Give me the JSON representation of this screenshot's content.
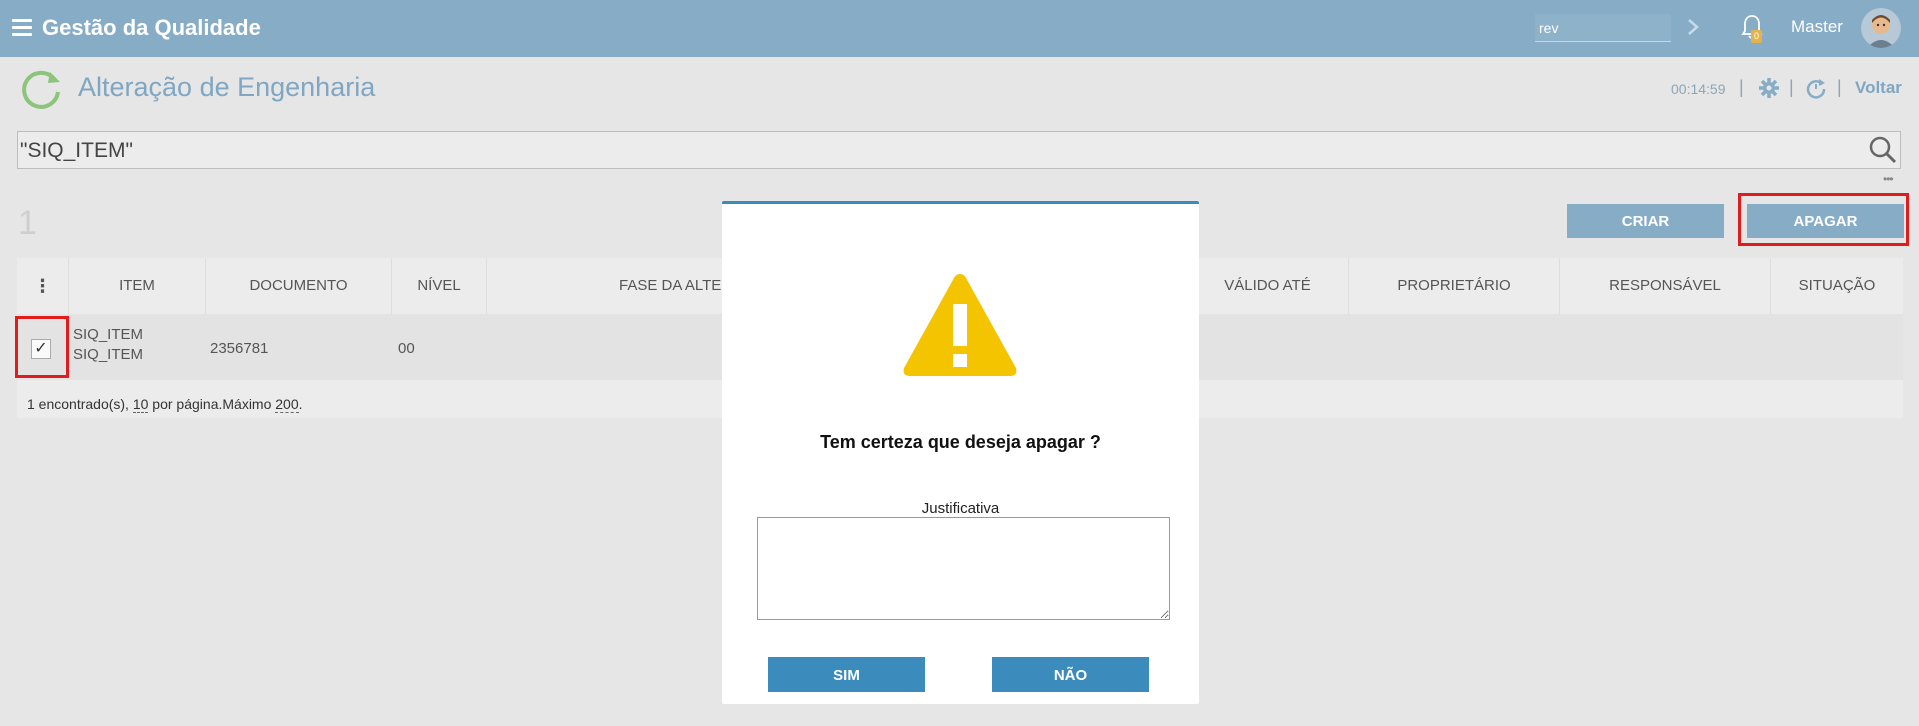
{
  "app": {
    "title": "Gestão da Qualidade"
  },
  "topbar": {
    "search_value": "rev",
    "notification_count": "0",
    "user_name": "Master"
  },
  "page": {
    "title": "Alteração de Engenharia",
    "timer": "00:14:59",
    "back_label": "Voltar",
    "separators": [
      "|",
      "|",
      "|"
    ]
  },
  "search": {
    "value": "\"SIQ_ITEM\"",
    "more": "•••"
  },
  "results": {
    "count": "1"
  },
  "actions": {
    "create_label": "CRIAR",
    "delete_label": "APAGAR"
  },
  "table": {
    "menu_icon": "⋮",
    "columns": [
      "ITEM",
      "DOCUMENTO",
      "NÍVEL",
      "FASE DA ALTERA",
      "VÁLIDO ATÉ",
      "PROPRIETÁRIO",
      "RESPONSÁVEL",
      "SITUAÇÃO"
    ],
    "rows": [
      {
        "checked": "✓",
        "item_line1": "SIQ_ITEM",
        "item_line2": "SIQ_ITEM",
        "documento": "2356781",
        "nivel": "00",
        "situacao_icon": "clock-icon"
      }
    ],
    "footer": {
      "found": "1 encontrado(s), ",
      "per_page_value": "10",
      "per_page_text": " por página.Máximo ",
      "max_value": "200",
      "end": "."
    }
  },
  "modal": {
    "message": "Tem certeza que deseja apagar ?",
    "justification_label": "Justificativa",
    "justification_value": "",
    "yes_label": "SIM",
    "no_label": "NÃO"
  },
  "colors": {
    "topbar": "#86acc6",
    "accent_button": "#3b8bbd",
    "highlight": "#e21c1c",
    "warning": "#f5c400",
    "refresh_green": "#8cc47c"
  }
}
